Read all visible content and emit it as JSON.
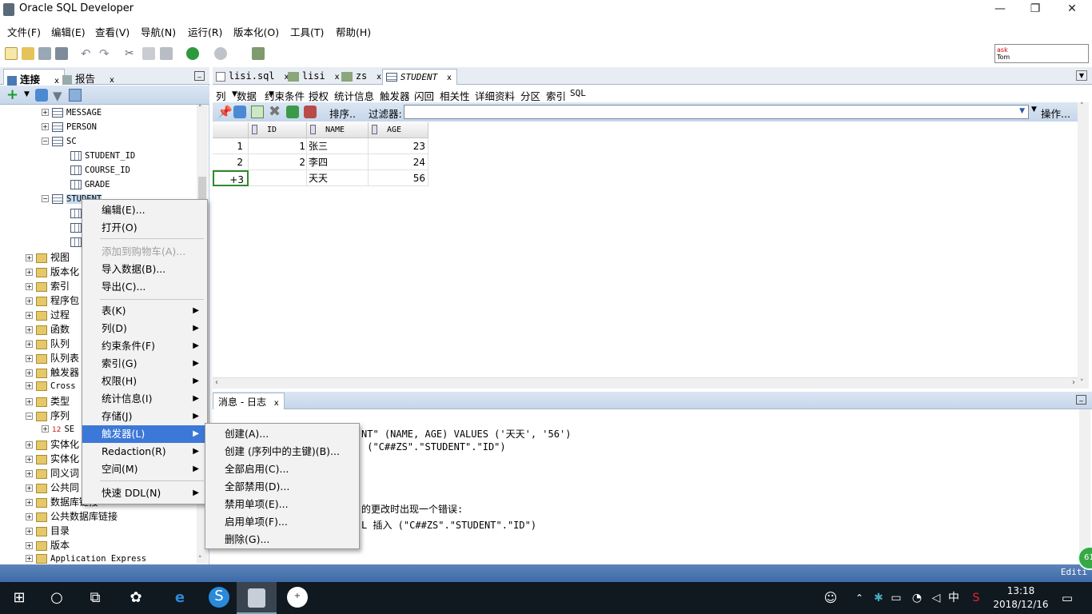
{
  "window": {
    "title": "Oracle SQL Developer",
    "controls": {
      "minimize": "—",
      "restore": "❐",
      "close": "✕"
    }
  },
  "menubar": [
    "文件(F)",
    "编辑(E)",
    "查看(V)",
    "导航(N)",
    "运行(R)",
    "版本化(O)",
    "工具(T)",
    "帮助(H)"
  ],
  "ask_box": {
    "line1": "ask",
    "line2": "Tom"
  },
  "left_panel": {
    "tabs": [
      {
        "label": "连接",
        "close": "x"
      },
      {
        "label": "报告",
        "close": "x"
      }
    ],
    "minimize": "_",
    "tree": [
      {
        "label": "MESSAGE",
        "icon": "table-icon"
      },
      {
        "label": "PERSON",
        "icon": "table-icon"
      },
      {
        "label": "SC",
        "icon": "table-icon"
      },
      {
        "label": "STUDENT_ID",
        "icon": "column-icon"
      },
      {
        "label": "COURSE_ID",
        "icon": "column-icon"
      },
      {
        "label": "GRADE",
        "icon": "column-icon"
      },
      {
        "label": "STUDENT",
        "icon": "table-icon"
      },
      {
        "label": "视图"
      },
      {
        "label": "版本化"
      },
      {
        "label": "索引"
      },
      {
        "label": "程序包"
      },
      {
        "label": "过程"
      },
      {
        "label": "函数"
      },
      {
        "label": "队列"
      },
      {
        "label": "队列表"
      },
      {
        "label": "触发器"
      },
      {
        "label": "Cross"
      },
      {
        "label": "类型"
      },
      {
        "label": "序列"
      },
      {
        "label": "SE"
      },
      {
        "label": "实体化"
      },
      {
        "label": "实体化"
      },
      {
        "label": "同义词"
      },
      {
        "label": "公共同"
      },
      {
        "label": "数据库链接"
      },
      {
        "label": "公共数据库链接"
      },
      {
        "label": "目录"
      },
      {
        "label": "版本"
      },
      {
        "label": "Application Express"
      }
    ]
  },
  "doc_tabs": [
    {
      "label": "lisi.sql",
      "close": "x"
    },
    {
      "label": "lisi",
      "close": "x"
    },
    {
      "label": "zs",
      "close": "x"
    },
    {
      "label": "STUDENT",
      "close": "x",
      "active": true
    }
  ],
  "sub_tabs": [
    "列",
    "数据",
    "约束条件",
    "授权",
    "统计信息",
    "触发器",
    "闪回",
    "相关性",
    "详细资料",
    "分区",
    "索引",
    "SQL"
  ],
  "grid_toolbar": {
    "sort": "排序..",
    "filter_label": "过滤器:",
    "actions": "操作..."
  },
  "grid": {
    "columns": [
      "ID",
      "NAME",
      "AGE"
    ],
    "rows": [
      {
        "rownum": "1",
        "id": "1",
        "name": "张三",
        "age": "23"
      },
      {
        "rownum": "2",
        "id": "2",
        "name": "李四",
        "age": "24"
      },
      {
        "rownum": "+3",
        "id": "",
        "name": "天天",
        "age": "56"
      }
    ]
  },
  "log": {
    "tab": "消息 - 日志",
    "close": "x",
    "lines": [
      "NT\" (NAME, AGE) VALUES ('天天', '56')",
      " (\"C##ZS\".\"STUDENT\".\"ID\")",
      "的更改时出现一个错误:",
      "L 插入 (\"C##ZS\".\"STUDENT\".\"ID\")"
    ]
  },
  "status": {
    "text": "Editi",
    "badge": "61"
  },
  "context_menu": {
    "items": [
      {
        "label": "编辑(E)..."
      },
      {
        "label": "打开(O)"
      },
      {
        "sep": true
      },
      {
        "label": "添加到购物车(A)...",
        "disabled": true
      },
      {
        "label": "导入数据(B)..."
      },
      {
        "label": "导出(C)..."
      },
      {
        "sep": true
      },
      {
        "label": "表(K)",
        "sub": true
      },
      {
        "label": "列(D)",
        "sub": true
      },
      {
        "label": "约束条件(F)",
        "sub": true
      },
      {
        "label": "索引(G)",
        "sub": true
      },
      {
        "label": "权限(H)",
        "sub": true
      },
      {
        "label": "统计信息(I)",
        "sub": true
      },
      {
        "label": "存储(J)",
        "sub": true
      },
      {
        "label": "触发器(L)",
        "sub": true,
        "active": true
      },
      {
        "label": "Redaction(R)",
        "sub": true
      },
      {
        "label": "空间(M)",
        "sub": true
      },
      {
        "sep": true
      },
      {
        "label": "快速 DDL(N)",
        "sub": true
      }
    ],
    "submenu": [
      "创建(A)...",
      "创建 (序列中的主键)(B)...",
      "全部启用(C)...",
      "全部禁用(D)...",
      "禁用单项(E)...",
      "启用单项(F)...",
      "删除(G)..."
    ]
  },
  "taskbar": {
    "time": "13:18",
    "date": "2018/12/16",
    "ime": "中"
  }
}
